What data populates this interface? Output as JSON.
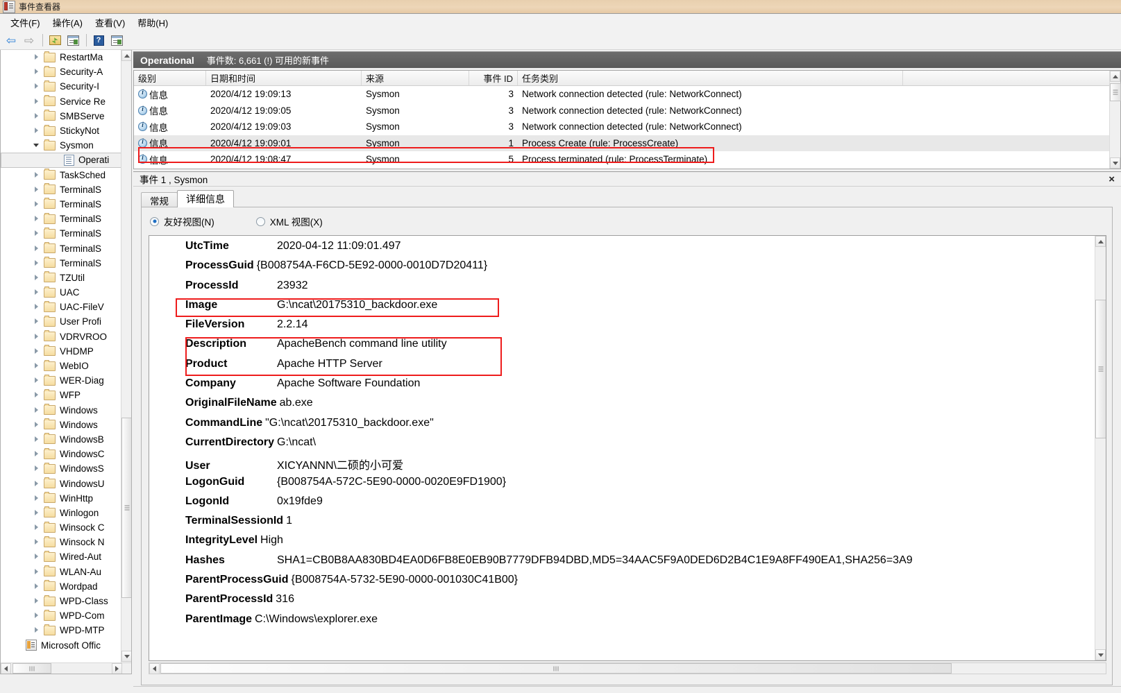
{
  "window": {
    "title": "事件查看器",
    "icon": "event-viewer-icon"
  },
  "menubar": {
    "items": [
      {
        "label": "文件(F)",
        "name": "menu-file"
      },
      {
        "label": "操作(A)",
        "name": "menu-action"
      },
      {
        "label": "查看(V)",
        "name": "menu-view"
      },
      {
        "label": "帮助(H)",
        "name": "menu-help"
      }
    ]
  },
  "toolbar": {
    "buttons": [
      {
        "name": "back-arrow-icon",
        "glyph": "⇦"
      },
      {
        "name": "forward-arrow-icon",
        "glyph": "⇨"
      },
      {
        "name": "show-hide-tree-icon"
      },
      {
        "name": "properties-icon"
      },
      {
        "name": "help-icon",
        "glyph": "?"
      },
      {
        "name": "show-action-pane-icon"
      }
    ]
  },
  "tree": {
    "items": [
      {
        "label": "RestartMa",
        "type": "folder",
        "state": "collapsed"
      },
      {
        "label": "Security-A",
        "type": "folder",
        "state": "collapsed"
      },
      {
        "label": "Security-I",
        "type": "folder",
        "state": "collapsed"
      },
      {
        "label": "Service Re",
        "type": "folder",
        "state": "collapsed"
      },
      {
        "label": "SMBServe",
        "type": "folder",
        "state": "collapsed"
      },
      {
        "label": "StickyNot",
        "type": "folder",
        "state": "collapsed"
      },
      {
        "label": "Sysmon",
        "type": "folder",
        "state": "expanded"
      },
      {
        "label": "Operati",
        "type": "log",
        "state": "selected"
      },
      {
        "label": "TaskSched",
        "type": "folder",
        "state": "collapsed"
      },
      {
        "label": "TerminalS",
        "type": "folder",
        "state": "collapsed"
      },
      {
        "label": "TerminalS",
        "type": "folder",
        "state": "collapsed"
      },
      {
        "label": "TerminalS",
        "type": "folder",
        "state": "collapsed"
      },
      {
        "label": "TerminalS",
        "type": "folder",
        "state": "collapsed"
      },
      {
        "label": "TerminalS",
        "type": "folder",
        "state": "collapsed"
      },
      {
        "label": "TerminalS",
        "type": "folder",
        "state": "collapsed"
      },
      {
        "label": "TZUtil",
        "type": "folder",
        "state": "collapsed"
      },
      {
        "label": "UAC",
        "type": "folder",
        "state": "collapsed"
      },
      {
        "label": "UAC-FileV",
        "type": "folder",
        "state": "collapsed"
      },
      {
        "label": "User Profi",
        "type": "folder",
        "state": "collapsed"
      },
      {
        "label": "VDRVROO",
        "type": "folder",
        "state": "collapsed"
      },
      {
        "label": "VHDMP",
        "type": "folder",
        "state": "collapsed"
      },
      {
        "label": "WebIO",
        "type": "folder",
        "state": "collapsed"
      },
      {
        "label": "WER-Diag",
        "type": "folder",
        "state": "collapsed"
      },
      {
        "label": "WFP",
        "type": "folder",
        "state": "collapsed"
      },
      {
        "label": "Windows",
        "type": "folder",
        "state": "collapsed"
      },
      {
        "label": "Windows",
        "type": "folder",
        "state": "collapsed"
      },
      {
        "label": "WindowsB",
        "type": "folder",
        "state": "collapsed"
      },
      {
        "label": "WindowsC",
        "type": "folder",
        "state": "collapsed"
      },
      {
        "label": "WindowsS",
        "type": "folder",
        "state": "collapsed"
      },
      {
        "label": "WindowsU",
        "type": "folder",
        "state": "collapsed"
      },
      {
        "label": "WinHttp",
        "type": "folder",
        "state": "collapsed"
      },
      {
        "label": "Winlogon",
        "type": "folder",
        "state": "collapsed"
      },
      {
        "label": "Winsock C",
        "type": "folder",
        "state": "collapsed"
      },
      {
        "label": "Winsock N",
        "type": "folder",
        "state": "collapsed"
      },
      {
        "label": "Wired-Aut",
        "type": "folder",
        "state": "collapsed"
      },
      {
        "label": "WLAN-Au",
        "type": "folder",
        "state": "collapsed"
      },
      {
        "label": "Wordpad",
        "type": "folder",
        "state": "collapsed"
      },
      {
        "label": "WPD-Class",
        "type": "folder",
        "state": "collapsed"
      },
      {
        "label": "WPD-Com",
        "type": "folder",
        "state": "collapsed"
      },
      {
        "label": "WPD-MTP",
        "type": "folder",
        "state": "collapsed"
      },
      {
        "label": "Microsoft Offic",
        "type": "office",
        "state": "root"
      }
    ]
  },
  "log_header": {
    "name": "Operational",
    "count_text": "事件数: 6,661 (!) 可用的新事件"
  },
  "event_list": {
    "columns": [
      "级别",
      "日期和时间",
      "来源",
      "事件 ID",
      "任务类别"
    ],
    "rows": [
      {
        "level": "信息",
        "datetime": "2020/4/12 19:09:13",
        "source": "Sysmon",
        "event_id": "3",
        "task": "Network connection detected (rule: NetworkConnect)",
        "selected": false
      },
      {
        "level": "信息",
        "datetime": "2020/4/12 19:09:05",
        "source": "Sysmon",
        "event_id": "3",
        "task": "Network connection detected (rule: NetworkConnect)",
        "selected": false
      },
      {
        "level": "信息",
        "datetime": "2020/4/12 19:09:03",
        "source": "Sysmon",
        "event_id": "3",
        "task": "Network connection detected (rule: NetworkConnect)",
        "selected": false
      },
      {
        "level": "信息",
        "datetime": "2020/4/12 19:09:01",
        "source": "Sysmon",
        "event_id": "1",
        "task": "Process Create (rule: ProcessCreate)",
        "selected": true
      },
      {
        "level": "信息",
        "datetime": "2020/4/12 19:08:47",
        "source": "Sysmon",
        "event_id": "5",
        "task": "Process terminated (rule: ProcessTerminate)",
        "selected": false
      }
    ]
  },
  "detail": {
    "title": "事件 1 , Sysmon",
    "close_label": "×",
    "tabs": [
      {
        "label": "常规",
        "active": false
      },
      {
        "label": "详细信息",
        "active": true
      }
    ],
    "view_modes": [
      {
        "label": "友好视图(N)",
        "selected": true
      },
      {
        "label": "XML 视图(X)",
        "selected": false
      }
    ],
    "fields": [
      {
        "name": "UtcTime",
        "value": "2020-04-12 11:09:01.497"
      },
      {
        "name": "ProcessGuid",
        "value": "{B008754A-F6CD-5E92-0000-0010D7D20411}"
      },
      {
        "name": "ProcessId",
        "value": "23932"
      },
      {
        "name": "Image",
        "value": "G:\\ncat\\20175310_backdoor.exe"
      },
      {
        "name": "FileVersion",
        "value": "2.2.14"
      },
      {
        "name": "Description",
        "value": "ApacheBench command line utility"
      },
      {
        "name": "Product",
        "value": "Apache HTTP Server"
      },
      {
        "name": "Company",
        "value": "Apache Software Foundation"
      },
      {
        "name": "OriginalFileName",
        "value": "ab.exe"
      },
      {
        "name": "CommandLine",
        "value": "\"G:\\ncat\\20175310_backdoor.exe\""
      },
      {
        "name": "CurrentDirectory",
        "value": "G:\\ncat\\"
      },
      {
        "name": "User",
        "value": "XICYANNN\\二硕的小可爱"
      },
      {
        "name": "LogonGuid",
        "value": "{B008754A-572C-5E90-0000-0020E9FD1900}"
      },
      {
        "name": "LogonId",
        "value": "0x19fde9"
      },
      {
        "name": "TerminalSessionId",
        "value": "1"
      },
      {
        "name": "IntegrityLevel",
        "value": "High"
      },
      {
        "name": "Hashes",
        "value": "SHA1=CB0B8AA830BD4EA0D6FB8E0EB90B7779DFB94DBD,MD5=34AAC5F9A0DED6D2B4C1E9A8FF490EA1,SHA256=3A9"
      },
      {
        "name": "ParentProcessGuid",
        "value": "{B008754A-5732-5E90-0000-001030C41B00}"
      },
      {
        "name": "ParentProcessId",
        "value": "316"
      },
      {
        "name": "ParentImage",
        "value": "C:\\Windows\\explorer.exe"
      }
    ]
  },
  "colors": {
    "highlight": "#ee1c1c",
    "header_bar": "#5a5a5a",
    "selection": "#e8e8e8"
  }
}
